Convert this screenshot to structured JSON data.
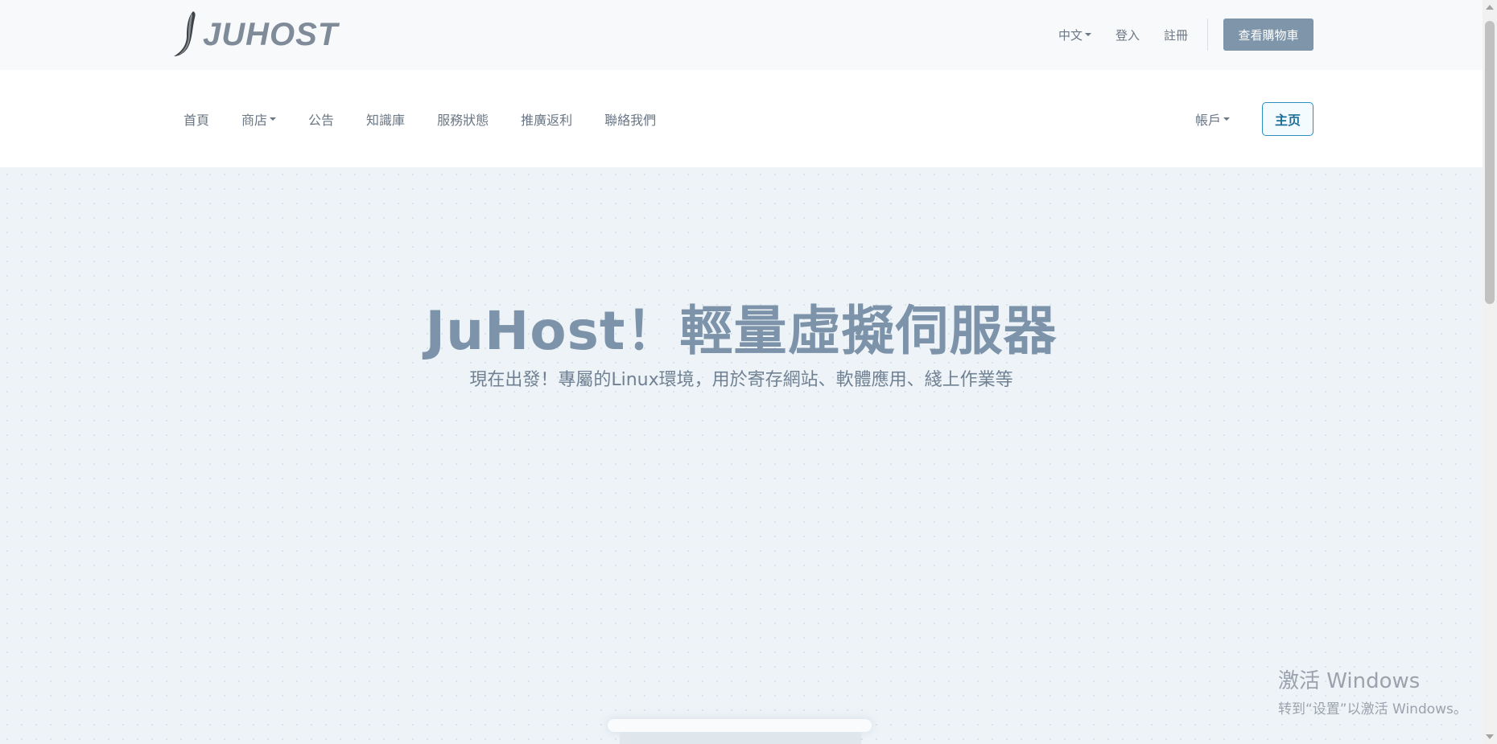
{
  "brand": {
    "logo_text": "JUHOST",
    "logo_color": "#7f8b99"
  },
  "topbar": {
    "language_label": "中文",
    "login_label": "登入",
    "register_label": "註冊",
    "cart_button_label": "查看購物車",
    "cart_button_color": "#7e95aa"
  },
  "nav": {
    "items": [
      {
        "label": "首頁",
        "has_dropdown": false
      },
      {
        "label": "商店",
        "has_dropdown": true
      },
      {
        "label": "公告",
        "has_dropdown": false
      },
      {
        "label": "知識庫",
        "has_dropdown": false
      },
      {
        "label": "服務狀態",
        "has_dropdown": false
      },
      {
        "label": "推廣返利",
        "has_dropdown": false
      },
      {
        "label": "聯絡我們",
        "has_dropdown": false
      }
    ],
    "account_label": "帳戶",
    "home_button_label": "主页",
    "home_button_color": "#2a8fbf"
  },
  "hero": {
    "title": "JuHost！輕量虛擬伺服器",
    "subtitle": "現在出發！專屬的Linux環境，用於寄存網站、軟體應用、綫上作業等",
    "title_color": "#7c93aa"
  },
  "watermark": {
    "title": "激活 Windows",
    "subtitle": "转到“设置”以激活 Windows。"
  }
}
